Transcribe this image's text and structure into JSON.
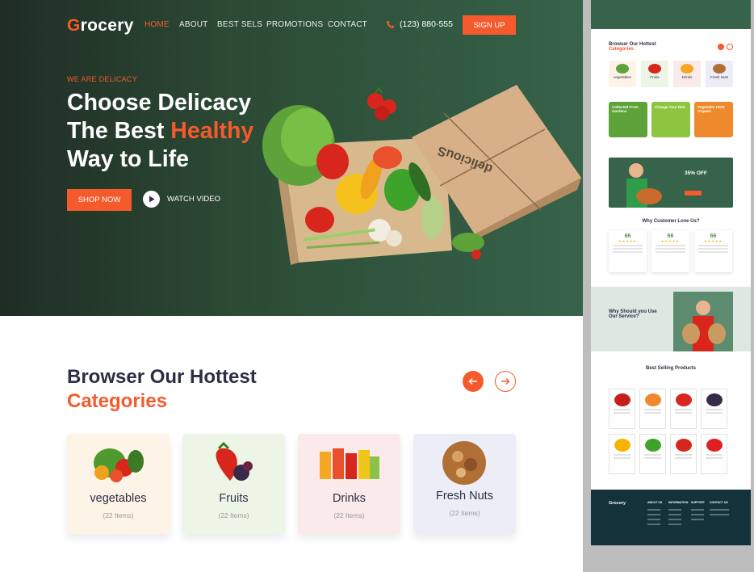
{
  "brand": {
    "logo_first": "G",
    "logo_rest": "rocery",
    "accent": "#f55a2c",
    "hero_green": "#36634a"
  },
  "nav": {
    "home": "HOME",
    "about": "ABOUT",
    "best_sels": "BEST SELS",
    "promotions": "PROMOTIONS",
    "contact": "CONTACT"
  },
  "header": {
    "phone_icon": "phone-icon",
    "phone": "(123) 880-555",
    "signup": "SIGN UP"
  },
  "hero": {
    "eyebrow": "WE ARE DELICACY",
    "line1": "Choose Delicacy",
    "line2_a": "The Best ",
    "line2_b": "Healthy",
    "line3": "Way to Life",
    "shop_now": "SHOP NOW",
    "watch_video": "WATCH VIDEO"
  },
  "categories": {
    "title": "Browser Our Hottest",
    "title_accent": "Categories",
    "items": [
      {
        "name": "vegetables",
        "count": "(22 Items)",
        "bg": "#fdf3e6"
      },
      {
        "name": "Fruits",
        "count": "(22 Items)",
        "bg": "#ecf5e6"
      },
      {
        "name": "Drinks",
        "count": "(22 Items)",
        "bg": "#fbeaea"
      },
      {
        "name": "Fresh Nuts",
        "count": "(22 Items)",
        "bg": "#ededf8"
      }
    ]
  },
  "preview": {
    "cat_title": "Browser Our Hottest",
    "cat_accent": "Categories",
    "cats": [
      "vegetables",
      "Fruits",
      "Drinks",
      "Fresh Nuts"
    ],
    "promos": [
      "Collected From Gardens",
      "Change Your Diet",
      "Vegetable 100% Organic"
    ],
    "discount": "35% OFF",
    "love_title": "Why Customer Love Us?",
    "reviews": [
      "66",
      "66",
      "66"
    ],
    "why_title": "Why Should you Use Our Service?",
    "best_title": "Best Selling Products",
    "footer_logo": "Grocery",
    "footer_cols": [
      "ABOUT US",
      "INFORMATION",
      "SUPPORT",
      "CONTACT US"
    ]
  }
}
